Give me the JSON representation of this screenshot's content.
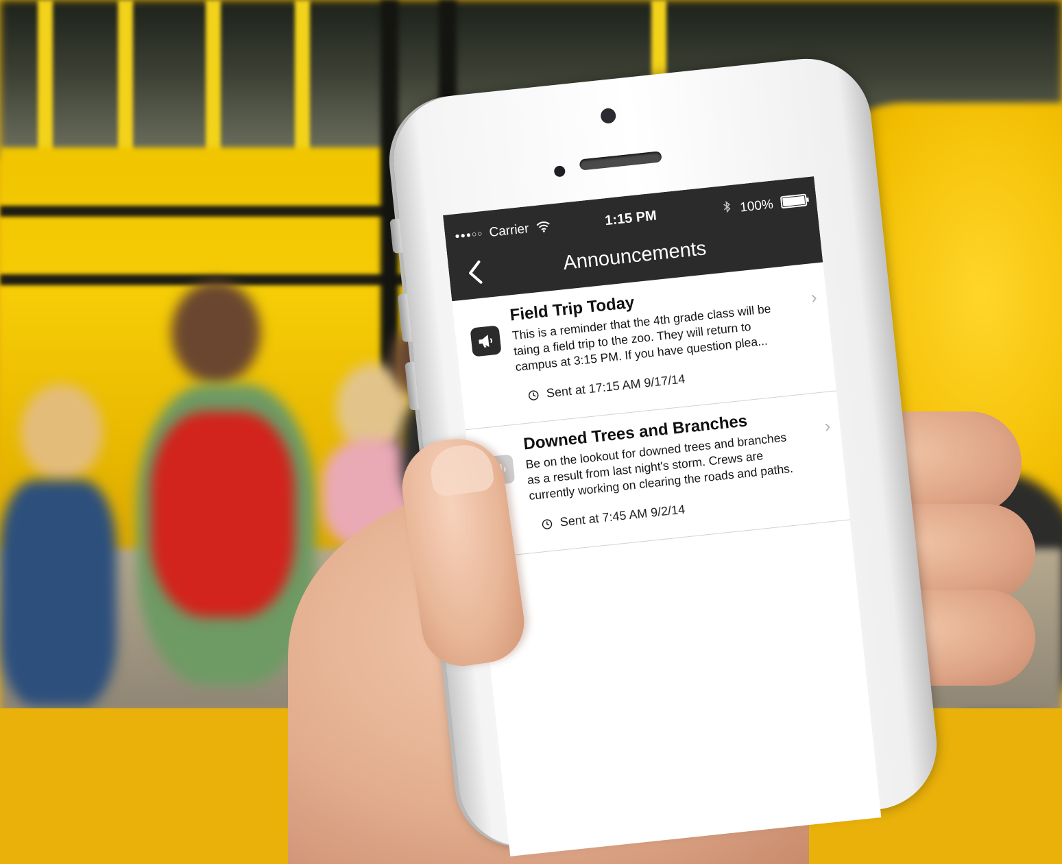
{
  "status_bar": {
    "signal": "●●●○○",
    "carrier": "Carrier",
    "time": "1:15 PM",
    "battery_percent": "100%"
  },
  "nav": {
    "title": "Announcements",
    "back_icon": "chevron-left-icon"
  },
  "announcements": [
    {
      "title": "Field Trip Today",
      "body": "This is a reminder that the 4th grade class will be taing a field trip to the zoo. They will return to campus at 3:15 PM. If you have question plea...",
      "sent": "Sent at 17:15 AM 9/17/14",
      "icon": "megaphone-icon",
      "unread": true
    },
    {
      "title": "Downed Trees and Branches",
      "body": "Be on the lookout for downed trees and branches as a result from last night's storm. Crews are currently working on clearing the roads and paths.",
      "sent": "Sent at 7:45 AM 9/2/14",
      "icon": "megaphone-icon",
      "unread": false
    }
  ],
  "colors": {
    "nav_background": "#2b2b2b",
    "icon_unread": "#2b2b2b",
    "icon_read": "#cfcfcf",
    "chevron": "#b3b3b3",
    "bus_yellow": "#f2c200"
  }
}
